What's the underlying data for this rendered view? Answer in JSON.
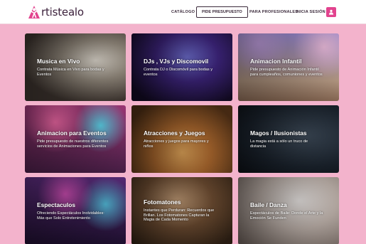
{
  "brand": {
    "logo_text": "rtistealo",
    "accent": "#e2438e",
    "page_bg": "#f3b3cc"
  },
  "nav": {
    "catalogo": "CATÁLOGO",
    "pide_presupuesto": "PIDE PRESUPUESTO",
    "para_profesionales": "PARA PROFESIONALES",
    "iniciar_sesion": "INICIA SESIÓN",
    "user_icon": "user-icon"
  },
  "cards": [
    {
      "title": "Musica en Vivo",
      "desc": [
        "Contrata Música en Vivo para bodas y",
        "Eventos"
      ],
      "bg": "#4a3f3a"
    },
    {
      "title": "DJs , VJs y Discomovil",
      "desc": [
        "Contrata DJ o Discomóvil para bodas y",
        "eventos"
      ],
      "bg": "#2b1a4d"
    },
    {
      "title": "Animacion Infantil",
      "desc": [
        "Pide presupuesto de Animación Infantil",
        "para cumpleaños, comuniones y eventos"
      ],
      "bg": "#8b7bc4"
    },
    {
      "title": "Animacion para Eventos",
      "desc": [
        "Pide presupuesto de nuestros diferentes",
        "servicios de Animaciones para Eventos"
      ],
      "bg": "#7a2b62"
    },
    {
      "title": "Atracciones y Juegos",
      "desc": [
        "Atracciones y juegos para mayores y",
        "niños"
      ],
      "bg": "#8a5a2e"
    },
    {
      "title": "Magos / Ilusionistas",
      "desc": [
        "La magia está a sólo un truco de",
        "distancia"
      ],
      "bg": "#1c2530"
    },
    {
      "title": "Espectaculos",
      "desc": [
        "Ofreciendo Espectáculos Inolvidables:",
        "Más que Solo Entretenimiento"
      ],
      "bg": "#3a2458"
    },
    {
      "title": "Fotomatones",
      "desc": [
        "Instantes que Perduran: Recuerdos que",
        "Brillan. Los Fotomatones Capturan la",
        "Magia de Cada Momento"
      ],
      "bg": "#4d3a28"
    },
    {
      "title": "Baile / Danza",
      "desc": [
        "Espectáculos de Baile: Donde el Arte y la",
        "Emoción Se Funden"
      ],
      "bg": "#b7aaa3"
    }
  ]
}
